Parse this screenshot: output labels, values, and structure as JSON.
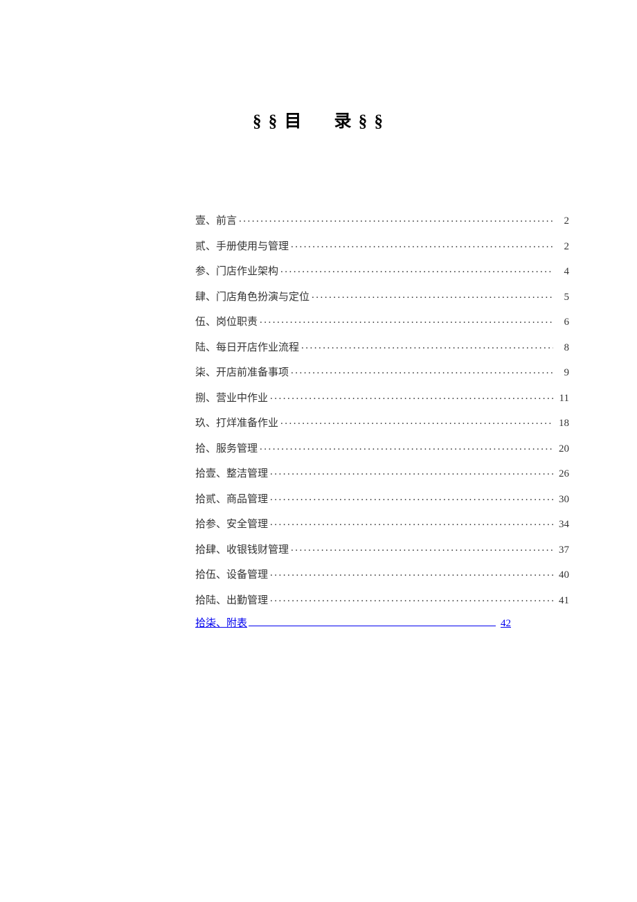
{
  "title": {
    "prefix": "§ §",
    "part1": "目",
    "part2": "录",
    "suffix": "§ §"
  },
  "toc": [
    {
      "label": "壹、前言",
      "page": "2",
      "link": false
    },
    {
      "label": "贰、手册使用与管理",
      "page": "2",
      "link": false
    },
    {
      "label": "参、门店作业架构",
      "page": "4",
      "link": false
    },
    {
      "label": "肆、门店角色扮演与定位",
      "page": "5",
      "link": false
    },
    {
      "label": "伍、岗位职责",
      "page": "6",
      "link": false
    },
    {
      "label": "陆、每日开店作业流程",
      "page": "8",
      "link": false
    },
    {
      "label": "柒、开店前准备事项",
      "page": "9",
      "link": false
    },
    {
      "label": "捌、营业中作业",
      "page": "11",
      "link": false
    },
    {
      "label": "玖、打烊准备作业",
      "page": "18",
      "link": false
    },
    {
      "label": "拾、服务管理",
      "page": "20",
      "link": false
    },
    {
      "label": "拾壹、整洁管理",
      "page": "26",
      "link": false
    },
    {
      "label": "拾贰、商品管理",
      "page": "30",
      "link": false
    },
    {
      "label": "拾参、安全管理",
      "page": "34",
      "link": false
    },
    {
      "label": "拾肆、收银钱财管理",
      "page": "37",
      "link": false
    },
    {
      "label": "拾伍、设备管理",
      "page": "40",
      "link": false
    },
    {
      "label": "拾陆、出勤管理",
      "page": "41",
      "link": false
    },
    {
      "label": "拾柒、附表",
      "page": "42",
      "link": true
    }
  ]
}
